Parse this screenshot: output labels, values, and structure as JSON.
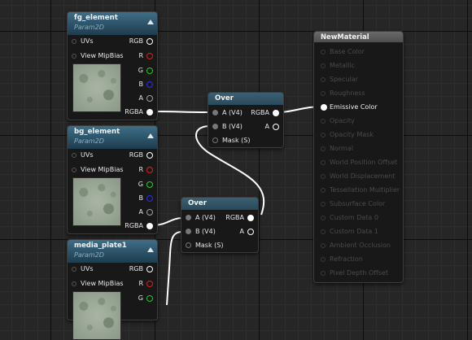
{
  "nodes": {
    "fg": {
      "title": "fg_element",
      "subtitle": "Param2D",
      "inputs": [
        "UVs",
        "View MipBias"
      ],
      "outputs": [
        "RGB",
        "R",
        "G",
        "B",
        "A",
        "RGBA"
      ]
    },
    "bg": {
      "title": "bg_element",
      "subtitle": "Param2D",
      "inputs": [
        "UVs",
        "View MipBias"
      ],
      "outputs": [
        "RGB",
        "R",
        "G",
        "B",
        "A",
        "RGBA"
      ]
    },
    "mp": {
      "title": "media_plate1",
      "subtitle": "Param2D",
      "inputs": [
        "UVs",
        "View MipBias"
      ],
      "outputs": [
        "RGB",
        "R",
        "G"
      ]
    },
    "over1": {
      "title": "Over",
      "inputs": [
        "A (V4)",
        "B (V4)",
        "Mask (S)"
      ],
      "outputs": [
        "RGBA",
        "A"
      ]
    },
    "over2": {
      "title": "Over",
      "inputs": [
        "A (V4)",
        "B (V4)",
        "Mask (S)"
      ],
      "outputs": [
        "RGBA",
        "A"
      ]
    },
    "material": {
      "title": "NewMaterial",
      "inputs": [
        "Base Color",
        "Metallic",
        "Specular",
        "Roughness",
        "Emissive Color",
        "Opacity",
        "Opacity Mask",
        "Normal",
        "World Position Offset",
        "World Displacement",
        "Tessellation Multiplier",
        "Subsurface Color",
        "Custom Data 0",
        "Custom Data 1",
        "Ambient Occlusion",
        "Refraction",
        "Pixel Depth Offset"
      ]
    }
  },
  "colors": {
    "wire": "#ffffff",
    "red_pin": "#e02020",
    "green_pin": "#20d020",
    "blue_pin": "#2a2aff"
  }
}
